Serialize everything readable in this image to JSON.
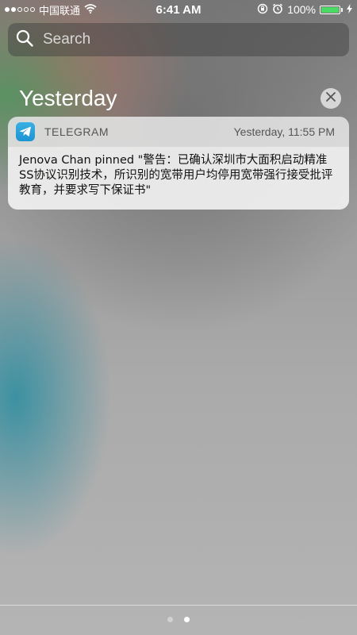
{
  "status_bar": {
    "carrier": "中国联通",
    "time": "6:41 AM",
    "battery": "100%",
    "signal_strength": 2,
    "signal_max": 5,
    "battery_level": 1.0,
    "battery_color": "#4cd964"
  },
  "search": {
    "placeholder": "Search"
  },
  "section": {
    "title": "Yesterday"
  },
  "notification": {
    "app_name": "TELEGRAM",
    "time": "Yesterday, 11:55 PM",
    "message": "Jenova Chan pinned \"警告：已确认深圳市大面积启动精准SS协议识别技术，所识别的宽带用户均停用宽带强行接受批评教育，并要求写下保证书\"",
    "app_color": "#2aa3dd"
  },
  "page_indicator": {
    "count": 2,
    "current": 2
  },
  "icons": {
    "search": "search-icon",
    "close": "close-icon",
    "wifi": "wifi-icon",
    "lock_rotation": "orientation-lock-icon",
    "alarm": "alarm-icon",
    "charging": "charging-bolt-icon",
    "telegram": "telegram-icon"
  }
}
